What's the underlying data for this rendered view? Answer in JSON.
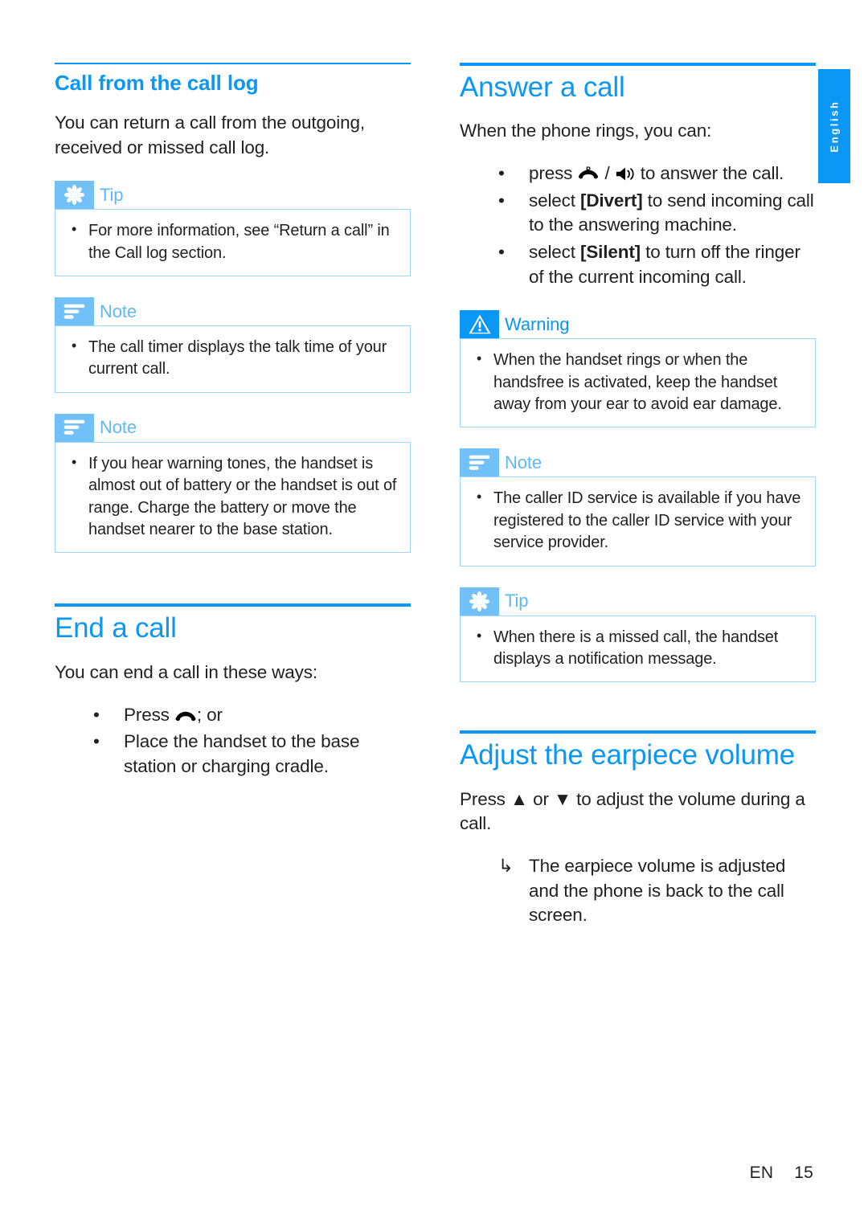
{
  "side_tab": {
    "language": "English"
  },
  "footer": {
    "lang_code": "EN",
    "page_number": "15"
  },
  "left_column": {
    "heading": "Call from the call log",
    "intro": "You can return a call from the outgoing, received or missed call log.",
    "callouts": [
      {
        "kind": "tip",
        "label": "Tip",
        "icon": "starburst-icon",
        "items": [
          "For more information, see “Return a call” in the Call log section."
        ]
      },
      {
        "kind": "note",
        "label": "Note",
        "icon": "lines-icon",
        "items": [
          "The call timer displays the talk time of your current call."
        ]
      },
      {
        "kind": "note",
        "label": "Note",
        "icon": "lines-icon",
        "items": [
          "If you hear warning tones, the handset is almost out of battery or the handset is out of range. Charge the battery or move the handset nearer to the base station."
        ]
      }
    ],
    "section2": {
      "heading": "End a call",
      "intro": "You can end a call in these ways:",
      "list": [
        {
          "marker": "•",
          "prefix": "Press ",
          "icon": "hangup-phone-icon",
          "suffix": "; or"
        },
        {
          "marker": "•",
          "text": "Place the handset to the base station or charging cradle."
        }
      ]
    }
  },
  "right_column": {
    "heading": "Answer a call",
    "intro": "When the phone rings, you can:",
    "list": [
      {
        "marker": "•",
        "prefix": "press ",
        "icon1": "talk-r-key-icon",
        "mid": " / ",
        "icon2": "speaker-icon",
        "suffix": " to answer the call."
      },
      {
        "marker": "•",
        "prefix": "select ",
        "bracket": "[Divert]",
        "suffix": " to send incoming call to the answering machine."
      },
      {
        "marker": "•",
        "prefix": "select ",
        "bracket": "[Silent]",
        "suffix": " to turn off the ringer of the current incoming call."
      }
    ],
    "callouts": [
      {
        "kind": "warning",
        "label": "Warning",
        "icon": "warning-triangle-icon",
        "items": [
          "When the handset rings or when the handsfree is activated, keep the handset away from your ear to avoid ear damage."
        ]
      },
      {
        "kind": "note",
        "label": "Note",
        "icon": "lines-icon",
        "items": [
          "The caller ID service is available if you have registered to the caller ID service with your service provider."
        ]
      },
      {
        "kind": "tip",
        "label": "Tip",
        "icon": "starburst-icon",
        "items": [
          "When there is a missed call, the handset displays a notification message."
        ]
      }
    ],
    "section2": {
      "heading": "Adjust the earpiece volume",
      "intro_prefix": "Press ",
      "up_glyph": "▲",
      "intro_mid": " or ",
      "down_glyph": "▼",
      "intro_suffix": " to adjust the volume during a call.",
      "result": {
        "marker": "↳",
        "text": "The earpiece volume is adjusted and the phone is back to the call screen."
      }
    }
  },
  "colors": {
    "accent_blue": "#0a97f5",
    "soft_blue": "#71c0f7",
    "label_blue": "#5fb9f5",
    "box_border": "#9ed6fa",
    "text": "#231f20"
  }
}
